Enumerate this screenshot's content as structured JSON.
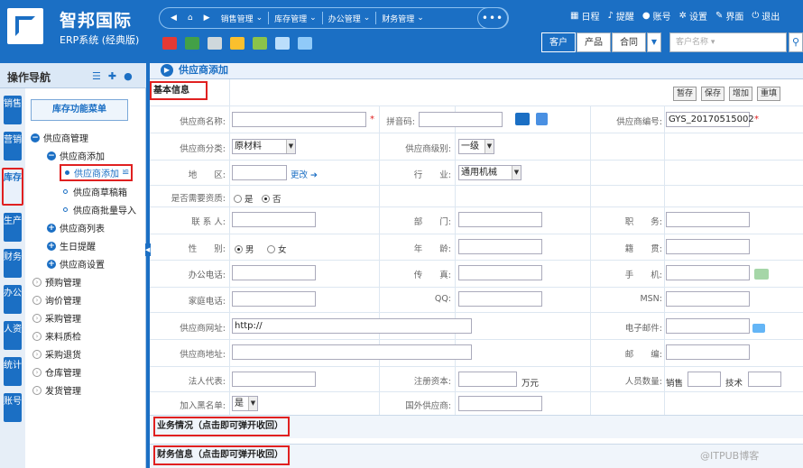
{
  "app": {
    "title": "智邦国际",
    "subtitle": "ERP系统 (经典版)"
  },
  "nav": {
    "items": [
      "销售管理",
      "库存管理",
      "办公管理",
      "财务管理"
    ],
    "more": "•••"
  },
  "top_links": [
    "日程",
    "提醒",
    "账号",
    "设置",
    "界面",
    "退出"
  ],
  "search": {
    "tabs": [
      "客户",
      "产品",
      "合同"
    ],
    "active_tab": "客户",
    "placeholder": "客户名称"
  },
  "left": {
    "title": "操作导航",
    "vtabs": [
      "销售",
      "营销",
      "库存",
      "生产",
      "财务",
      "办公",
      "人资",
      "统计",
      "账号"
    ],
    "active_vtab": "库存",
    "func_menu": "库存功能菜单",
    "tree": [
      {
        "label": "供应商管理",
        "level": 0,
        "icon": "minus"
      },
      {
        "label": "供应商添加",
        "level": 1,
        "icon": "minus"
      },
      {
        "label": "供应商添加",
        "level": 2,
        "icon": "dot",
        "selected": true,
        "suffix": "≌"
      },
      {
        "label": "供应商草稿箱",
        "level": 2,
        "icon": "odot"
      },
      {
        "label": "供应商批量导入",
        "level": 2,
        "icon": "odot"
      },
      {
        "label": "供应商列表",
        "level": 1,
        "icon": "plus"
      },
      {
        "label": "生日提醒",
        "level": 1,
        "icon": "plus"
      },
      {
        "label": "供应商设置",
        "level": 1,
        "icon": "plus"
      },
      {
        "label": "预购管理",
        "level": 0,
        "icon": "ring"
      },
      {
        "label": "询价管理",
        "level": 0,
        "icon": "ring"
      },
      {
        "label": "采购管理",
        "level": 0,
        "icon": "ring"
      },
      {
        "label": "来料质检",
        "level": 0,
        "icon": "ring"
      },
      {
        "label": "采购退货",
        "level": 0,
        "icon": "ring"
      },
      {
        "label": "仓库管理",
        "level": 0,
        "icon": "ring"
      },
      {
        "label": "发货管理",
        "level": 0,
        "icon": "ring"
      }
    ]
  },
  "main": {
    "title": "供应商添加",
    "section": "基本信息",
    "buttons": [
      "暂存",
      "保存",
      "增加",
      "重填"
    ],
    "fields": {
      "name_label": "供应商名称:",
      "pinyin_label": "拼音码:",
      "code_label": "供应商编号:",
      "code_value": "GYS_20170515002",
      "category_label": "供应商分类:",
      "category_value": "原材料",
      "level_label": "供应商级别:",
      "level_value": "一级",
      "region_label": "地　　区:",
      "region_change": "更改",
      "industry_label": "行　　业:",
      "industry_value": "通用机械",
      "need_qual_label": "是否需要资质:",
      "need_qual_options": [
        "是",
        "否"
      ],
      "contact_label": "联 系 人:",
      "dept_label": "部　　门:",
      "position_label": "职　　务:",
      "gender_label": "性　　别:",
      "gender_options": [
        "男",
        "女"
      ],
      "age_label": "年　　龄:",
      "origin_label": "籍　　贯:",
      "office_phone_label": "办公电话:",
      "fax_label": "传　　真:",
      "mobile_label": "手　　机:",
      "home_phone_label": "家庭电话:",
      "qq_label": "QQ:",
      "msn_label": "MSN:",
      "website_label": "供应商网址:",
      "website_value": "http://",
      "email_label": "电子邮件:",
      "address_label": "供应商地址:",
      "zip_label": "邮　　编:",
      "legal_label": "法人代表:",
      "capital_label": "注册资本:",
      "capital_unit": "万元",
      "staff_label": "人员数量:",
      "staff_sales": "销售",
      "staff_tech": "技术",
      "blacklist_label": "加入黑名单:",
      "blacklist_value": "是",
      "foreign_label": "国外供应商:"
    },
    "collapse1": "业务情况（点击即可弹开收回）",
    "collapse2": "财务信息（点击即可弹开收回）"
  },
  "watermark": "@ITPUB博客",
  "colors": {
    "primary": "#1b6fc4",
    "highlight": "#e02020"
  }
}
